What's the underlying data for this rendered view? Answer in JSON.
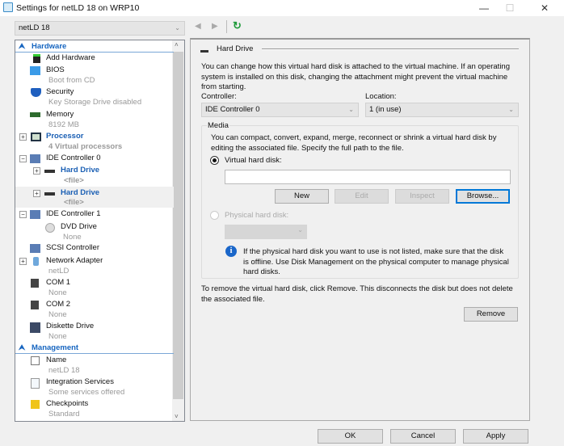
{
  "window": {
    "title": "Settings for netLD 18 on WRP10",
    "minimize": "—",
    "maximize": "☐",
    "close": "✕"
  },
  "vm_selector": {
    "value": "netLD 18"
  },
  "tree": {
    "hardware_header": "Hardware",
    "items": [
      {
        "label": "Add Hardware"
      },
      {
        "label": "BIOS",
        "sub": "Boot from CD"
      },
      {
        "label": "Security",
        "sub": "Key Storage Drive disabled"
      },
      {
        "label": "Memory",
        "sub": "8192 MB"
      },
      {
        "label": "Processor",
        "sub": "4 Virtual processors"
      },
      {
        "label": "IDE Controller 0"
      },
      {
        "label": "Hard Drive",
        "sub": "<file>"
      },
      {
        "label": "Hard Drive",
        "sub": "<file>"
      },
      {
        "label": "IDE Controller 1"
      },
      {
        "label": "DVD Drive",
        "sub": "None"
      },
      {
        "label": "SCSI Controller"
      },
      {
        "label": "Network Adapter",
        "sub": "netLD"
      },
      {
        "label": "COM 1",
        "sub": "None"
      },
      {
        "label": "COM 2",
        "sub": "None"
      },
      {
        "label": "Diskette Drive",
        "sub": "None"
      }
    ],
    "management_header": "Management",
    "mgmt_items": [
      {
        "label": "Name",
        "sub": "netLD 18"
      },
      {
        "label": "Integration Services",
        "sub": "Some services offered"
      },
      {
        "label": "Checkpoints",
        "sub": "Standard"
      }
    ]
  },
  "panel": {
    "title": "Hard Drive",
    "description": "You can change how this virtual hard disk is attached to the virtual machine. If an operating system is installed on this disk, changing the attachment might prevent the virtual machine from starting.",
    "controller_label": "Controller:",
    "controller_value": "IDE Controller 0",
    "location_label": "Location:",
    "location_value": "1 (in use)",
    "media_label": "Media",
    "media_description": "You can compact, convert, expand, merge, reconnect or shrink a virtual hard disk by editing the associated file. Specify the full path to the file.",
    "vhd_label": "Virtual hard disk:",
    "vhd_path": "",
    "new": "New",
    "edit": "Edit",
    "inspect": "Inspect",
    "browse": "Browse...",
    "physical_label": "Physical hard disk:",
    "info": "If the physical hard disk you want to use is not listed, make sure that the disk is offline. Use Disk Management on the physical computer to manage physical hard disks.",
    "remove_description": "To remove the virtual hard disk, click Remove. This disconnects the disk but does not delete the associated file.",
    "remove": "Remove"
  },
  "footer": {
    "ok": "OK",
    "cancel": "Cancel",
    "apply": "Apply"
  }
}
